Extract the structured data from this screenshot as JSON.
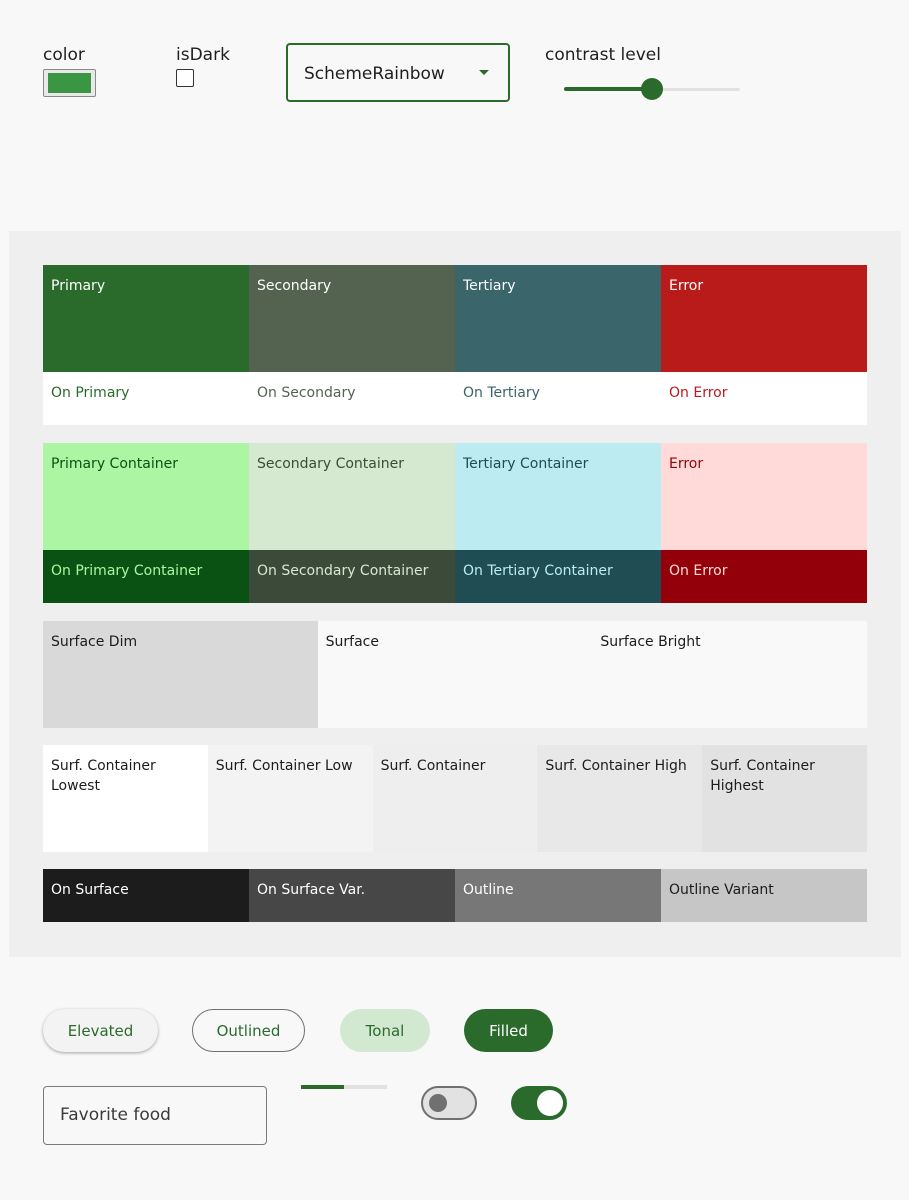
{
  "controls": {
    "color_label": "color",
    "seed_color": "#3a9642",
    "isdark_label": "isDark",
    "isdark_checked": false,
    "scheme_select_value": "SchemeRainbow",
    "contrast_label": "contrast level",
    "contrast_fraction": 0.5
  },
  "scheme": {
    "rows": [
      [
        {
          "label": "Primary",
          "bg": "#2a6b2c",
          "fg": "#ffffff"
        },
        {
          "label": "Secondary",
          "bg": "#536350",
          "fg": "#ffffff"
        },
        {
          "label": "Tertiary",
          "bg": "#39656b",
          "fg": "#ffffff"
        },
        {
          "label": "Error",
          "bg": "#b91b1b",
          "fg": "#ffffff"
        }
      ],
      [
        {
          "label": "On Primary",
          "bg": "#ffffff",
          "fg": "#2a6b2c"
        },
        {
          "label": "On Secondary",
          "bg": "#ffffff",
          "fg": "#536350"
        },
        {
          "label": "On Tertiary",
          "bg": "#ffffff",
          "fg": "#39656b"
        },
        {
          "label": "On Error",
          "bg": "#ffffff",
          "fg": "#b91b1b"
        }
      ],
      [
        {
          "label": "Primary Container",
          "bg": "#acf5a3",
          "fg": "#095213"
        },
        {
          "label": "Secondary Container",
          "bg": "#d5e8d0",
          "fg": "#3c4b39"
        },
        {
          "label": "Tertiary Container",
          "bg": "#bcebf1",
          "fg": "#1f4d53"
        },
        {
          "label": "Error",
          "bg": "#ffdad8",
          "fg": "#93000a"
        }
      ],
      [
        {
          "label": "On Primary Container",
          "bg": "#095213",
          "fg": "#acf5a3"
        },
        {
          "label": "On Secondary Container",
          "bg": "#3c4b39",
          "fg": "#d5e8d0"
        },
        {
          "label": "On Tertiary Container",
          "bg": "#1f4d53",
          "fg": "#bcebf1"
        },
        {
          "label": "On Error",
          "bg": "#93000a",
          "fg": "#ffdad8"
        }
      ],
      [
        {
          "label": "Surface Dim",
          "bg": "#d9d9d9",
          "fg": "#1c1c1c"
        },
        {
          "label": "Surface",
          "bg": "#f9f9f9",
          "fg": "#1c1c1c"
        },
        {
          "label": "Surface Bright",
          "bg": "#f9f9f9",
          "fg": "#1c1c1c"
        }
      ],
      [
        {
          "label": "Surf. Container Lowest",
          "bg": "#ffffff",
          "fg": "#1c1c1c"
        },
        {
          "label": "Surf. Container Low",
          "bg": "#f3f3f3",
          "fg": "#1c1c1c"
        },
        {
          "label": "Surf. Container",
          "bg": "#eeeeee",
          "fg": "#1c1c1c"
        },
        {
          "label": "Surf. Container High",
          "bg": "#e8e8e8",
          "fg": "#1c1c1c"
        },
        {
          "label": "Surf. Container Highest",
          "bg": "#e2e2e2",
          "fg": "#1c1c1c"
        }
      ],
      [
        {
          "label": "On Surface",
          "bg": "#1c1c1c",
          "fg": "#ffffff"
        },
        {
          "label": "On Surface Var.",
          "bg": "#474747",
          "fg": "#ffffff"
        },
        {
          "label": "Outline",
          "bg": "#777777",
          "fg": "#ffffff"
        },
        {
          "label": "Outline Variant",
          "bg": "#c6c6c6",
          "fg": "#1c1c1c"
        }
      ]
    ]
  },
  "buttons": {
    "elevated": "Elevated",
    "outlined": "Outlined",
    "tonal": "Tonal",
    "filled": "Filled"
  },
  "textfield": {
    "placeholder": "Favorite food"
  },
  "progress_fraction": 0.5,
  "switches": [
    false,
    true
  ]
}
